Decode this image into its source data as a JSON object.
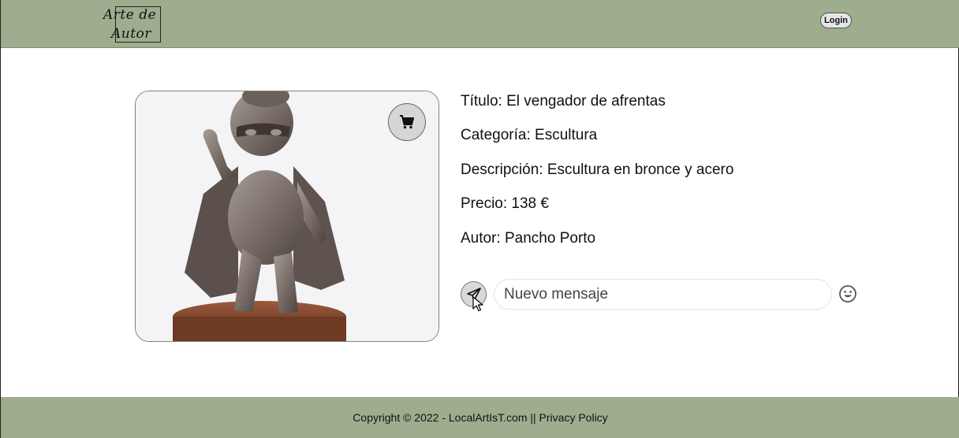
{
  "header": {
    "logo_line1": "Arte de",
    "logo_line2": "Autor",
    "login_label": "Login"
  },
  "product": {
    "image_alt": "Escultura de bronce: niño con capa y antifaz",
    "title_label": "Título:",
    "title": "El vengador de afrentas",
    "category_label": "Categoría:",
    "category": "Escultura",
    "description_label": "Descripción:",
    "description": "Escultura en bronce y acero",
    "price_label": "Precio:",
    "price": "138 €",
    "author_label": "Autor:",
    "author": "Pancho Porto"
  },
  "message": {
    "placeholder": "Nuevo mensaje"
  },
  "footer": {
    "copyright": "Copyright © 2022 - LocalArtIsT.com | ",
    "privacy_label": "| Privacy Policy"
  },
  "icons": {
    "cart": "shopping-cart-icon",
    "send": "paper-plane-icon",
    "emoji": "smiley-icon"
  },
  "colors": {
    "header_bg": "#9ead8d",
    "footer_bg": "#9ead8d"
  }
}
